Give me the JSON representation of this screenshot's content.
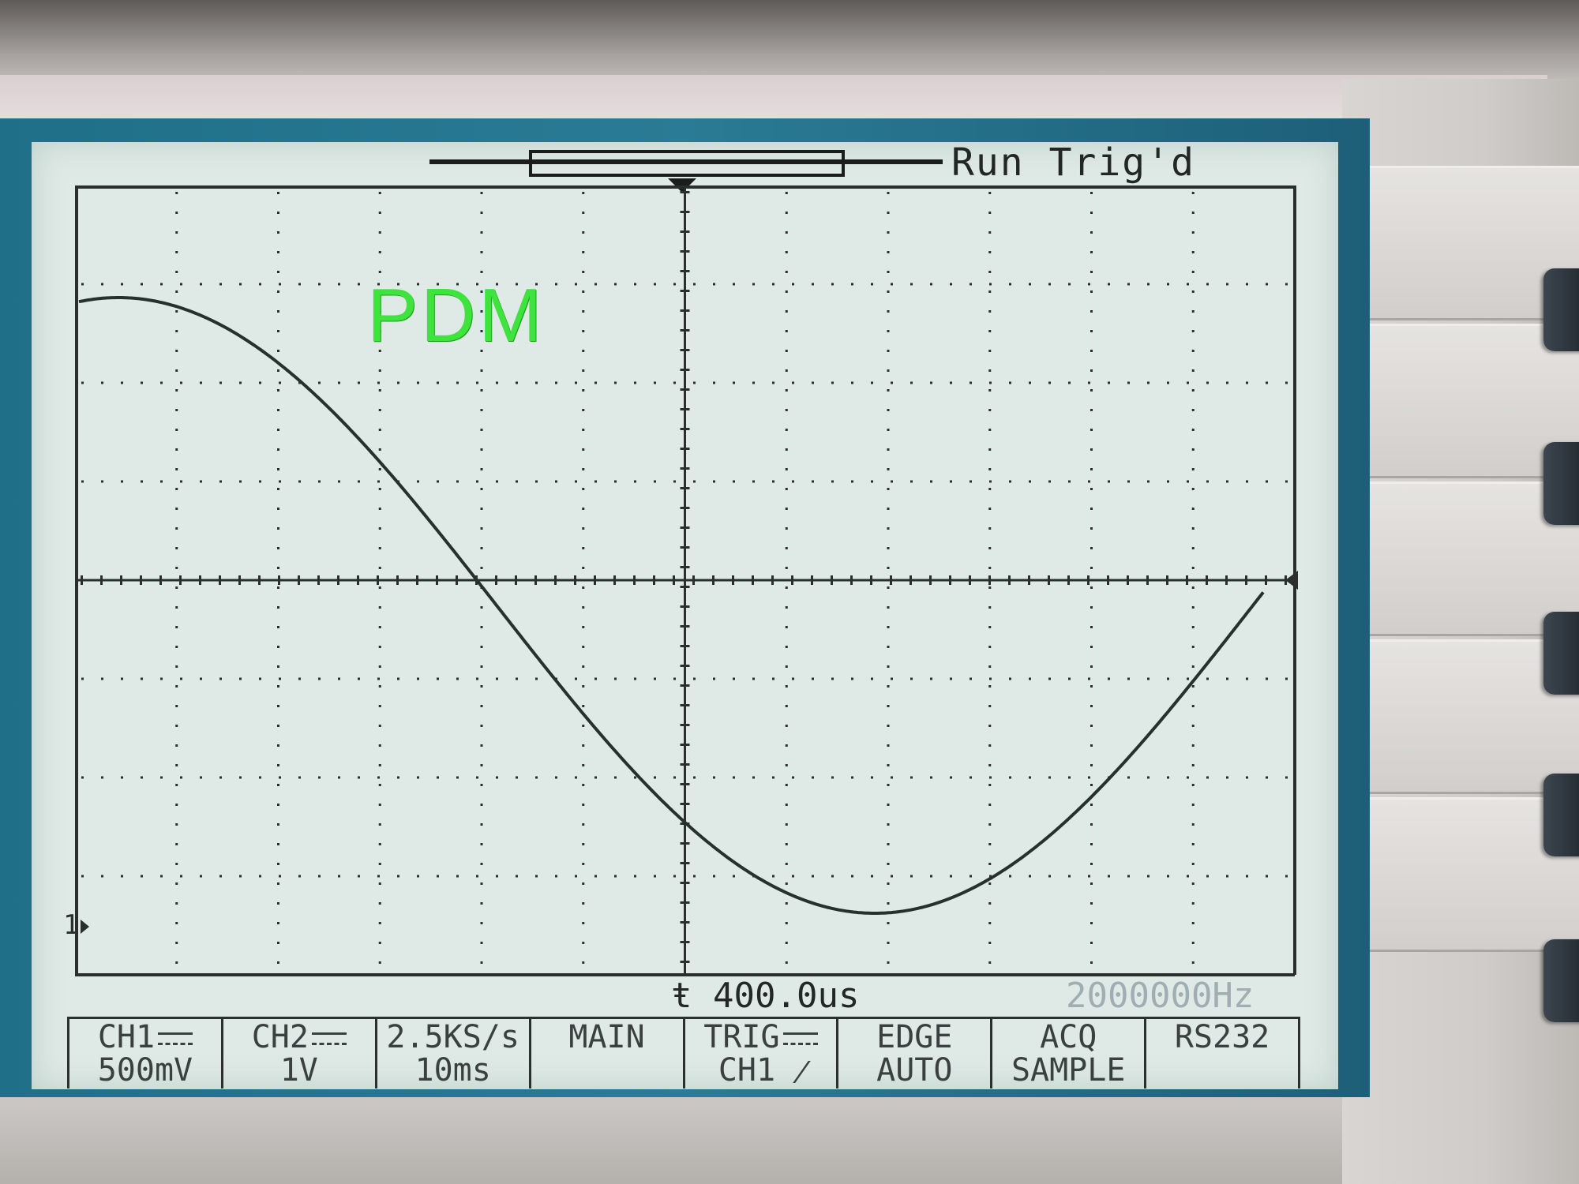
{
  "status": {
    "run_state": "Run Trig'd"
  },
  "annotation": {
    "label": "PDM"
  },
  "channel_marker": {
    "label": "1"
  },
  "readouts": {
    "time_position": "400.0us",
    "frequency": "2000000Hz"
  },
  "menu": [
    {
      "line1": "CH1",
      "line2": "500mV",
      "coupling": "dc"
    },
    {
      "line1": "CH2",
      "line2": "1V",
      "coupling": "dc"
    },
    {
      "line1": "2.5KS/s",
      "line2": "10ms"
    },
    {
      "line1": "MAIN",
      "line2": ""
    },
    {
      "line1": "TRIG",
      "line2": "CH1",
      "coupling": "dc",
      "slope": "rising"
    },
    {
      "line1": "EDGE",
      "line2": "AUTO"
    },
    {
      "line1": "ACQ",
      "line2": "SAMPLE"
    },
    {
      "line1": "RS232",
      "line2": ""
    }
  ],
  "waveform": {
    "shape": "sine",
    "trace_color": "#26302f",
    "grid_color": "#2a2f2e"
  },
  "colors": {
    "screen_background": "#dfe9e5",
    "bezel": "#2a7b95",
    "label_green": "#3ee33e"
  }
}
